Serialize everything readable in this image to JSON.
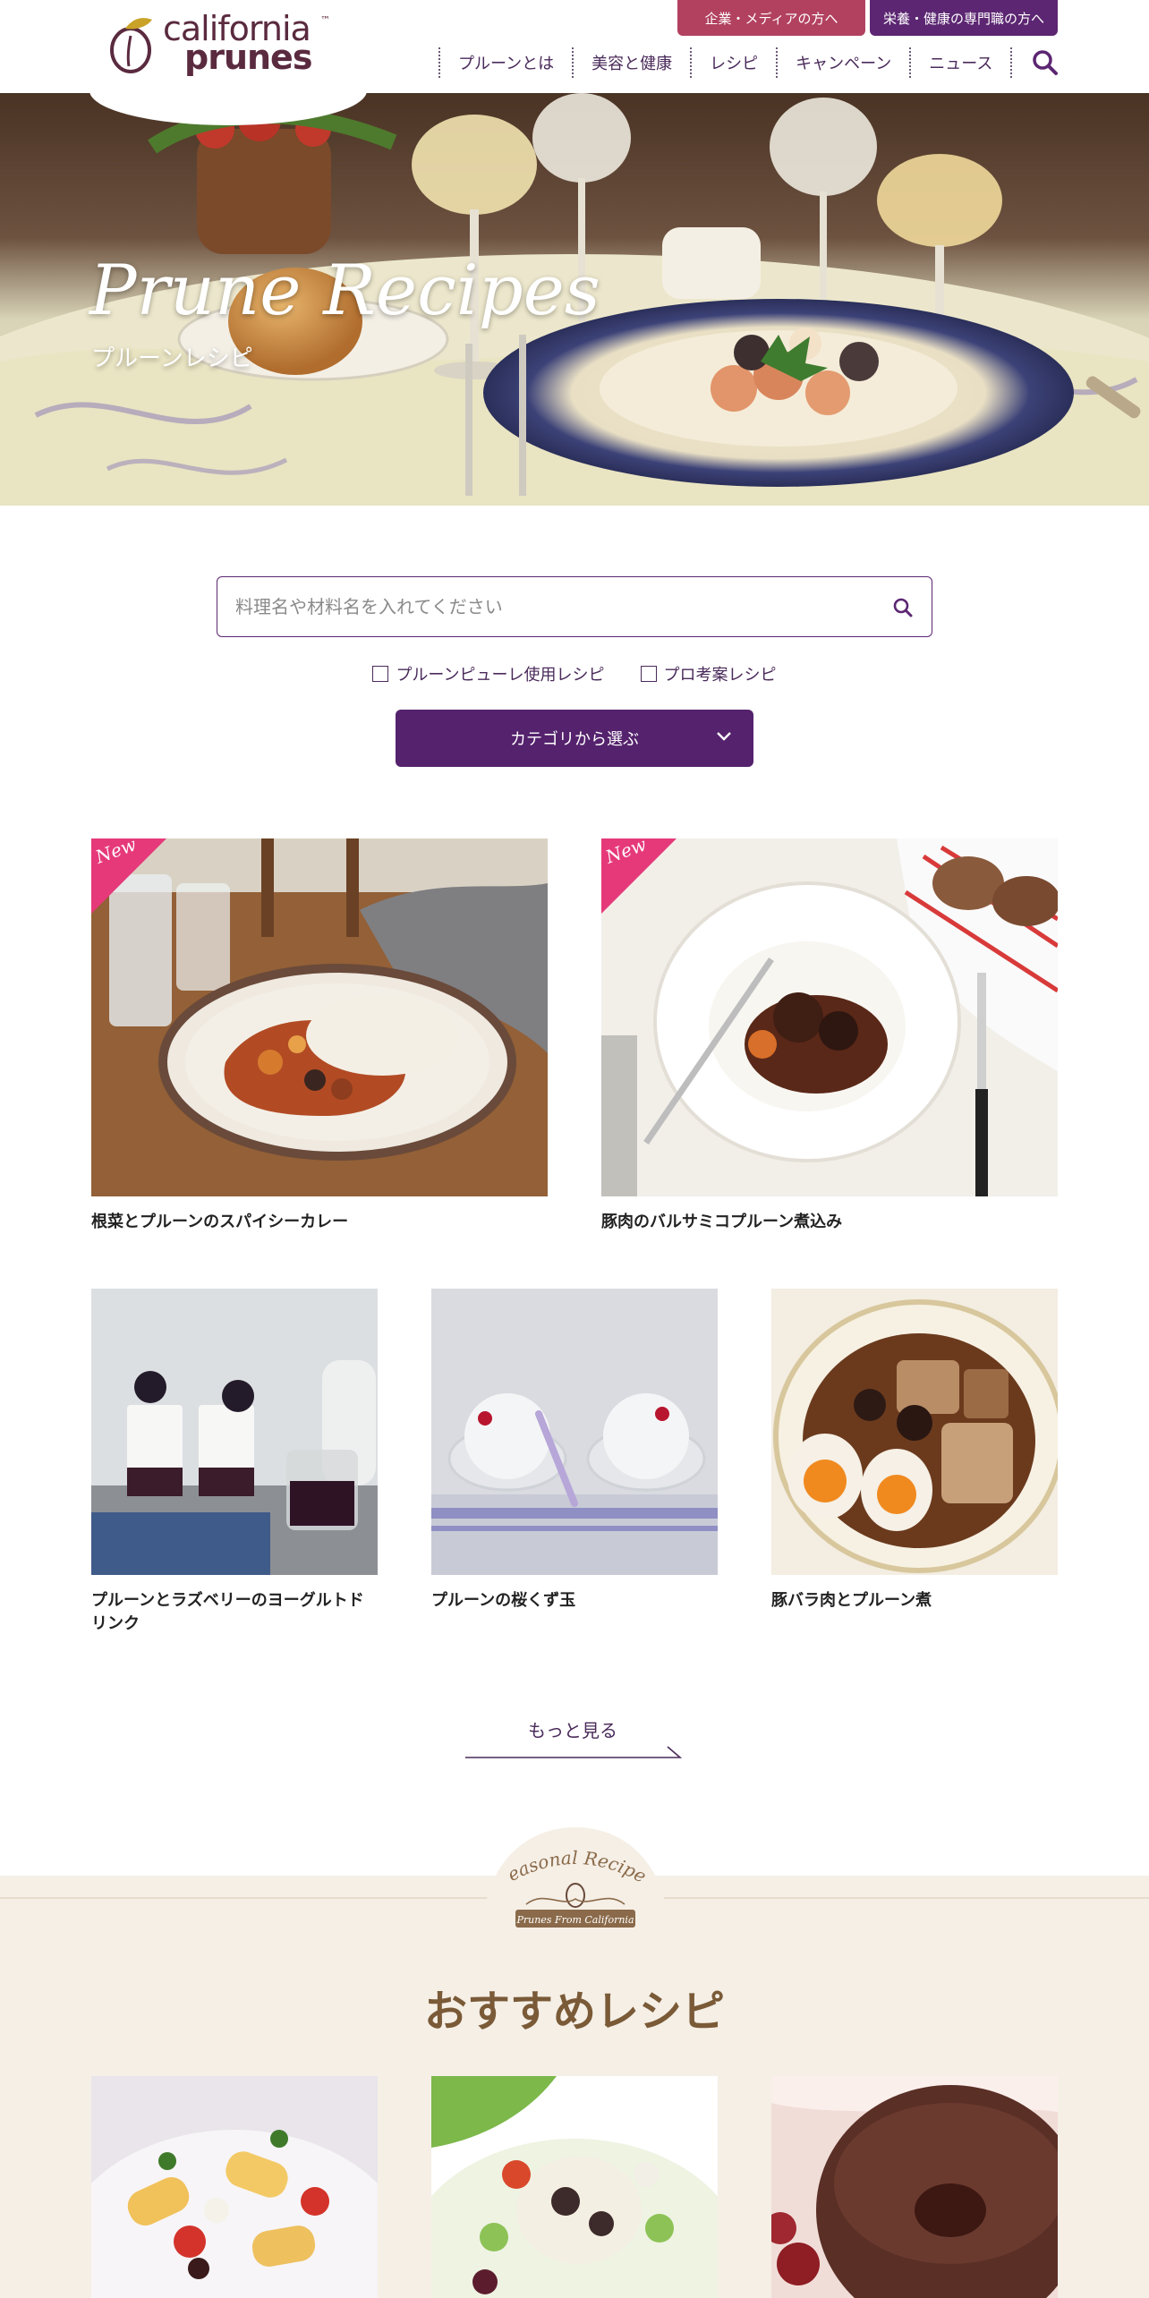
{
  "header": {
    "logo_top": "california",
    "logo_bottom": "prunes",
    "logo_tm": "™",
    "top_buttons": [
      {
        "label": "企業・メディアの方へ"
      },
      {
        "label": "栄養・健康の専門職の方へ"
      }
    ],
    "nav": [
      {
        "label": "プルーンとは"
      },
      {
        "label": "美容と健康"
      },
      {
        "label": "レシピ"
      },
      {
        "label": "キャンペーン"
      },
      {
        "label": "ニュース"
      }
    ]
  },
  "hero": {
    "title": "Prune Recipes",
    "subtitle": "プルーンレシピ",
    "slides": 2,
    "active_slide": 1
  },
  "search": {
    "placeholder": "料理名や材料名を入れてください",
    "value": ""
  },
  "filters": [
    {
      "label": "プルーンピューレ使用レシピ",
      "checked": false
    },
    {
      "label": "プロ考案レシピ",
      "checked": false
    }
  ],
  "category_button": {
    "label": "カテゴリから選ぶ"
  },
  "recipes": [
    {
      "title": "根菜とプルーンのスパイシーカレー",
      "badge": "New"
    },
    {
      "title": "豚肉のバルサミコプルーン煮込み",
      "badge": "New"
    },
    {
      "title": "プルーンとラズベリーのヨーグルトドリンク"
    },
    {
      "title": "プルーンの桜くず玉"
    },
    {
      "title": "豚バラ肉とプルーン煮"
    }
  ],
  "more": {
    "label": "もっと見る"
  },
  "recommended": {
    "badge_top": "Seasonal Recipes",
    "badge_bottom": "Prunes From California",
    "title": "おすすめレシピ"
  },
  "colors": {
    "brand_purple": "#5c2672",
    "media_red": "#b2415f",
    "reco_bg": "#f5efe6",
    "reco_title": "#7a5a37"
  }
}
